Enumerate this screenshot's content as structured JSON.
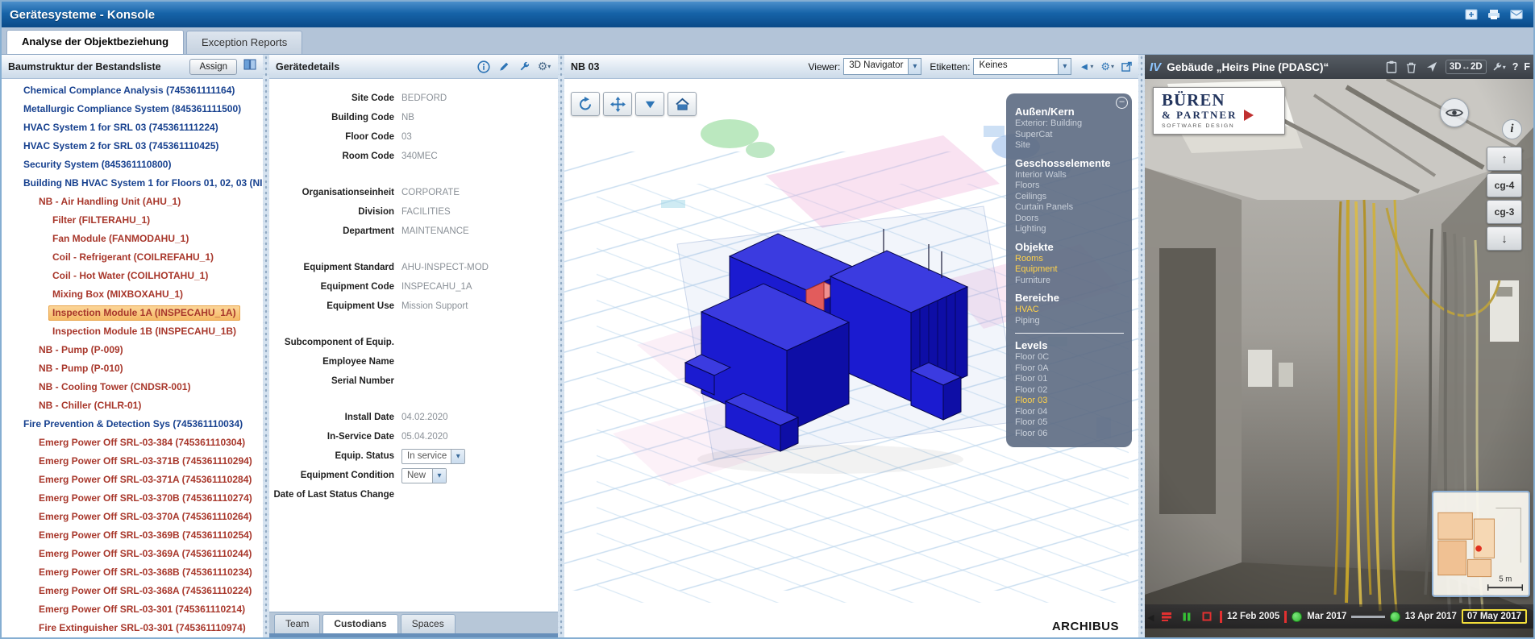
{
  "window": {
    "title": "Gerätesysteme - Konsole",
    "titlebar_icons": [
      "add-window-icon",
      "print-icon",
      "mail-icon"
    ]
  },
  "main_tabs": [
    {
      "label": "Analyse der Objektbeziehung",
      "active": true
    },
    {
      "label": "Exception Reports",
      "active": false
    }
  ],
  "tree_panel": {
    "title": "Baumstruktur der Bestandsliste",
    "assign_button": "Assign",
    "header_icons": [
      "columns-icon"
    ],
    "items": [
      {
        "label": "Chemical Complance Analysis (745361111164)",
        "level": 0,
        "kind": "system",
        "expand": "collapsed"
      },
      {
        "label": "Metallurgic Compliance System (845361111500)",
        "level": 0,
        "kind": "system",
        "expand": "collapsed"
      },
      {
        "label": "HVAC System 1 for SRL 03 (745361111224)",
        "level": 0,
        "kind": "system",
        "expand": "collapsed"
      },
      {
        "label": "HVAC System 2 for SRL 03 (745361110425)",
        "level": 0,
        "kind": "system",
        "expand": "collapsed"
      },
      {
        "label": "Security System (845361110800)",
        "level": 0,
        "kind": "system",
        "expand": "collapsed"
      },
      {
        "label": "Building NB HVAC System 1 for Floors 01, 02, 03 (NI",
        "level": 0,
        "kind": "system",
        "expand": "expanded"
      },
      {
        "label": "NB - Air Handling Unit (AHU_1)",
        "level": 1,
        "kind": "equipment",
        "expand": "expanded"
      },
      {
        "label": "Filter (FILTERAHU_1)",
        "level": 2,
        "kind": "equipment"
      },
      {
        "label": "Fan Module (FANMODAHU_1)",
        "level": 2,
        "kind": "equipment"
      },
      {
        "label": "Coil - Refrigerant (COILREFAHU_1)",
        "level": 2,
        "kind": "equipment"
      },
      {
        "label": "Coil - Hot Water (COILHOTAHU_1)",
        "level": 2,
        "kind": "equipment"
      },
      {
        "label": "Mixing Box (MIXBOXAHU_1)",
        "level": 2,
        "kind": "equipment"
      },
      {
        "label": "Inspection Module 1A (INSPECAHU_1A)",
        "level": 2,
        "kind": "equipment",
        "selected": true
      },
      {
        "label": "Inspection Module 1B (INSPECAHU_1B)",
        "level": 2,
        "kind": "equipment"
      },
      {
        "label": "NB - Pump (P-009)",
        "level": 1,
        "kind": "equipment"
      },
      {
        "label": "NB - Pump (P-010)",
        "level": 1,
        "kind": "equipment"
      },
      {
        "label": "NB - Cooling Tower (CNDSR-001)",
        "level": 1,
        "kind": "equipment"
      },
      {
        "label": "NB - Chiller (CHLR-01)",
        "level": 1,
        "kind": "equipment"
      },
      {
        "label": "Fire Prevention & Detection Sys (745361110034)",
        "level": 0,
        "kind": "system",
        "expand": "expanded"
      },
      {
        "label": "Emerg Power Off SRL-03-384 (745361110304)",
        "level": 1,
        "kind": "equipment"
      },
      {
        "label": "Emerg Power Off SRL-03-371B (745361110294)",
        "level": 1,
        "kind": "equipment"
      },
      {
        "label": "Emerg Power Off SRL-03-371A (745361110284)",
        "level": 1,
        "kind": "equipment"
      },
      {
        "label": "Emerg Power Off SRL-03-370B (745361110274)",
        "level": 1,
        "kind": "equipment"
      },
      {
        "label": "Emerg Power Off SRL-03-370A (745361110264)",
        "level": 1,
        "kind": "equipment"
      },
      {
        "label": "Emerg Power Off SRL-03-369B (745361110254)",
        "level": 1,
        "kind": "equipment"
      },
      {
        "label": "Emerg Power Off SRL-03-369A (745361110244)",
        "level": 1,
        "kind": "equipment"
      },
      {
        "label": "Emerg Power Off SRL-03-368B (745361110234)",
        "level": 1,
        "kind": "equipment"
      },
      {
        "label": "Emerg Power Off SRL-03-368A (745361110224)",
        "level": 1,
        "kind": "equipment"
      },
      {
        "label": "Emerg Power Off SRL-03-301 (745361110214)",
        "level": 1,
        "kind": "equipment"
      },
      {
        "label": "Fire Extinguisher SRL-03-301 (745361110974)",
        "level": 1,
        "kind": "equipment"
      }
    ]
  },
  "details_panel": {
    "title": "Gerätedetails",
    "header_icons": [
      "info-icon",
      "edit-icon",
      "wrench-icon",
      "gear-icon"
    ],
    "fields": [
      {
        "label": "Site Code",
        "value": "BEDFORD"
      },
      {
        "label": "Building Code",
        "value": "NB"
      },
      {
        "label": "Floor Code",
        "value": "03"
      },
      {
        "label": "Room Code",
        "value": "340MEC"
      },
      {
        "label": "Organisationseinheit",
        "value": "CORPORATE",
        "gap": true
      },
      {
        "label": "Division",
        "value": "FACILITIES"
      },
      {
        "label": "Department",
        "value": "MAINTENANCE"
      },
      {
        "label": "Equipment Standard",
        "value": "AHU-INSPECT-MOD",
        "gap": true
      },
      {
        "label": "Equipment Code",
        "value": "INSPECAHU_1A"
      },
      {
        "label": "Equipment Use",
        "value": "Mission Support"
      },
      {
        "label": "Subcomponent of Equip.",
        "value": "",
        "gap": true
      },
      {
        "label": "Employee Name",
        "value": ""
      },
      {
        "label": "Serial Number",
        "value": ""
      },
      {
        "label": "Install Date",
        "value": "04.02.2020",
        "gap": true
      },
      {
        "label": "In-Service Date",
        "value": "05.04.2020"
      },
      {
        "label": "Equip. Status",
        "value": "In service",
        "type": "select"
      },
      {
        "label": "Equipment Condition",
        "value": "New",
        "type": "select"
      },
      {
        "label": "Date of Last Status Change",
        "value": ""
      }
    ],
    "bottom_tabs": [
      {
        "label": "Team",
        "active": false
      },
      {
        "label": "Custodians",
        "active": true
      },
      {
        "label": "Spaces",
        "active": false
      }
    ]
  },
  "viewer3d": {
    "title": "NB 03",
    "viewer_label": "Viewer:",
    "viewer_value": "3D Navigator",
    "labels_label": "Etiketten:",
    "labels_value": "Keines",
    "header_icons": [
      "back-icon",
      "gear-icon",
      "expand-icon"
    ],
    "nav_icons": [
      "rotate-icon",
      "pan-icon",
      "down-arrow-icon",
      "home-icon"
    ],
    "watermark": "ARCHIBUS",
    "layers": [
      {
        "kind": "header",
        "label": "Außen/Kern"
      },
      {
        "kind": "item",
        "label": "Exterior: Building"
      },
      {
        "kind": "item",
        "label": "SuperCat"
      },
      {
        "kind": "item",
        "label": "Site"
      },
      {
        "kind": "header",
        "label": "Geschosselemente"
      },
      {
        "kind": "item",
        "label": "Interior Walls"
      },
      {
        "kind": "item",
        "label": "Floors"
      },
      {
        "kind": "item",
        "label": "Ceilings"
      },
      {
        "kind": "item",
        "label": "Curtain Panels"
      },
      {
        "kind": "item",
        "label": "Doors"
      },
      {
        "kind": "item",
        "label": "Lighting"
      },
      {
        "kind": "header",
        "label": "Objekte"
      },
      {
        "kind": "item",
        "label": "Rooms",
        "highlight": true
      },
      {
        "kind": "item",
        "label": "Equipment",
        "highlight": true
      },
      {
        "kind": "item",
        "label": "Furniture"
      },
      {
        "kind": "header",
        "label": "Bereiche"
      },
      {
        "kind": "item",
        "label": "HVAC",
        "highlight": true
      },
      {
        "kind": "item",
        "label": "Piping"
      },
      {
        "kind": "divider"
      },
      {
        "kind": "header",
        "label": "Levels"
      },
      {
        "kind": "item",
        "label": "Floor 0C"
      },
      {
        "kind": "item",
        "label": "Floor 0A"
      },
      {
        "kind": "item",
        "label": "Floor 01"
      },
      {
        "kind": "item",
        "label": "Floor 02"
      },
      {
        "kind": "item",
        "label": "Floor 03",
        "highlight": true
      },
      {
        "kind": "item",
        "label": "Floor 04"
      },
      {
        "kind": "item",
        "label": "Floor 05"
      },
      {
        "kind": "item",
        "label": "Floor 06"
      }
    ]
  },
  "pano_panel": {
    "logo": "IV",
    "title": "Gebäude „Heirs Pine (PDASC)“",
    "header_icons": [
      "clipboard-icon",
      "trash-icon",
      "compass-icon",
      "wrench-icon"
    ],
    "mode_toggle": "3D↔2D",
    "help_label": "?",
    "partial_label": "F",
    "vendor_logo": {
      "line1": "BÜREN",
      "line2": "& PARTNER",
      "line3": "SOFTWARE DESIGN"
    },
    "side_icons": [
      "eye-icon",
      "info-icon"
    ],
    "nav_buttons": [
      {
        "kind": "up",
        "label": ""
      },
      {
        "kind": "label",
        "label": "cg-4"
      },
      {
        "kind": "label",
        "label": "cg-3"
      },
      {
        "kind": "down",
        "label": ""
      }
    ],
    "minimap": {
      "scale_label": "5 m"
    },
    "timeline": {
      "control_icons": [
        "list-red-icon",
        "pause-green-icon",
        "stop-red-icon"
      ],
      "items": [
        {
          "kind": "tick"
        },
        {
          "kind": "date",
          "label": "12 Feb 2005"
        },
        {
          "kind": "tick"
        },
        {
          "kind": "dot"
        },
        {
          "kind": "date",
          "label": "Mar 2017"
        },
        {
          "kind": "track"
        },
        {
          "kind": "dot"
        },
        {
          "kind": "date",
          "label": "13 Apr 2017"
        },
        {
          "kind": "datebox",
          "label": "07 May 2017"
        }
      ]
    }
  }
}
